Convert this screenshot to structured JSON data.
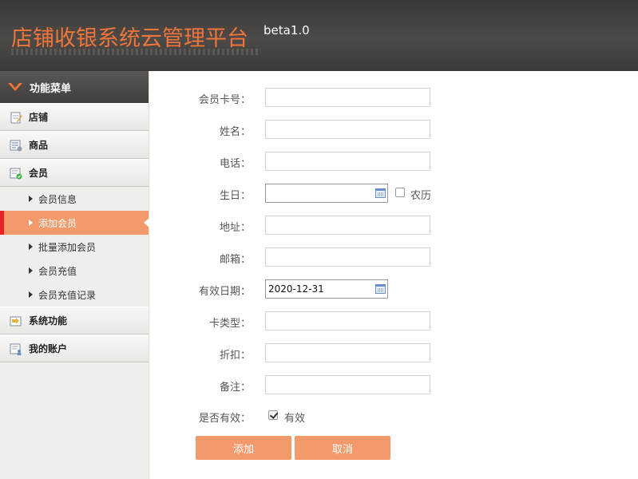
{
  "header": {
    "title": "店铺收银系统云管理平台",
    "version": "beta1.0"
  },
  "sidebar": {
    "menu_title": "功能菜单",
    "categories": [
      {
        "label": "店铺",
        "icon": "edit-doc-icon"
      },
      {
        "label": "商品",
        "icon": "list-settings-icon"
      },
      {
        "label": "会员",
        "icon": "member-card-icon"
      },
      {
        "label": "系统功能",
        "icon": "system-icon"
      },
      {
        "label": "我的账户",
        "icon": "account-icon"
      }
    ],
    "member_items": [
      {
        "label": "会员信息"
      },
      {
        "label": "添加会员"
      },
      {
        "label": "批量添加会员"
      },
      {
        "label": "会员充值"
      },
      {
        "label": "会员充值记录"
      }
    ]
  },
  "form": {
    "card_no": {
      "label": "会员卡号：",
      "value": ""
    },
    "name": {
      "label": "姓名：",
      "value": ""
    },
    "phone": {
      "label": "电话：",
      "value": ""
    },
    "birthday": {
      "label": "生日：",
      "value": "",
      "lunar_label": "农历",
      "lunar_checked": false
    },
    "address": {
      "label": "地址：",
      "value": ""
    },
    "email": {
      "label": "邮箱：",
      "value": ""
    },
    "valid_date": {
      "label": "有效日期：",
      "value": "2020-12-31"
    },
    "card_type": {
      "label": "卡类型：",
      "value": ""
    },
    "discount": {
      "label": "折扣：",
      "value": ""
    },
    "note": {
      "label": "备注：",
      "value": ""
    },
    "is_valid": {
      "label": "是否有效：",
      "option_label": "有效",
      "checked": true
    }
  },
  "buttons": {
    "add": "添加",
    "cancel": "取消"
  },
  "colors": {
    "accent": "#f29a6c",
    "brand": "#f0753a",
    "header_bg": "#45423f",
    "active_marker": "#e8202a"
  }
}
